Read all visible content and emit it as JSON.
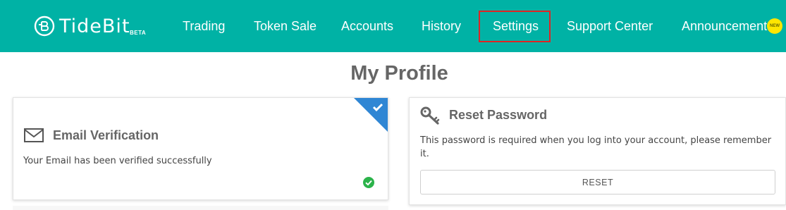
{
  "brand": {
    "name": "TideBit",
    "tag": "BETA"
  },
  "nav": {
    "items": [
      {
        "label": "Trading"
      },
      {
        "label": "Token Sale"
      },
      {
        "label": "Accounts"
      },
      {
        "label": "History"
      },
      {
        "label": "Settings"
      },
      {
        "label": "Support Center"
      },
      {
        "label": "Announcement"
      }
    ],
    "new_badge": "NEW",
    "highlighted": "Settings"
  },
  "page": {
    "title": "My Profile"
  },
  "email_card": {
    "title": "Email Verification",
    "message": "Your Email has been verified successfully",
    "icon": "envelope-icon",
    "status_icon": "check-circle-icon",
    "corner_icon": "checkmark-icon"
  },
  "reset_card": {
    "title": "Reset Password",
    "description": "This password is required when you log into your account, please remember it.",
    "button_label": "RESET",
    "icon": "key-icon"
  },
  "colors": {
    "nav_bg": "#00b2a5",
    "corner_blue": "#2f86d4",
    "success_green": "#2bb34a",
    "highlight_red": "#e02424",
    "badge_yellow": "#ffe600"
  }
}
